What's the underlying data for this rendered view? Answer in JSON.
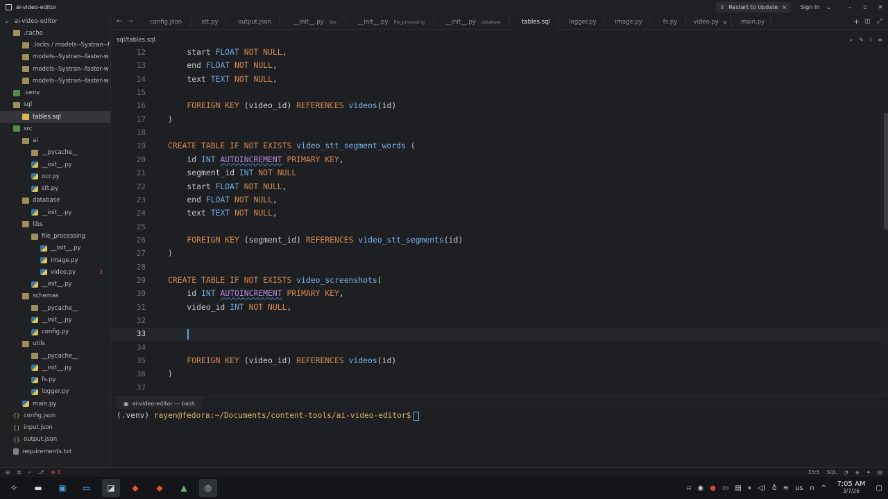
{
  "window": {
    "title": "ai-video-editor",
    "update_label": "Restart to Update",
    "sign_in_label": "Sign In"
  },
  "sidebar": {
    "items": [
      {
        "label": "ai-video-editor",
        "icon": "chevron-down-icon",
        "depth": 0
      },
      {
        "label": ".cache",
        "icon": "folder-icon",
        "depth": 1
      },
      {
        "label": ".locks / models--Systran--f",
        "icon": "folder-icon",
        "depth": 2
      },
      {
        "label": "models--Systran--faster-w",
        "icon": "folder-icon",
        "depth": 2
      },
      {
        "label": "models--Systran--faster-w",
        "icon": "folder-icon",
        "depth": 2
      },
      {
        "label": "models--Systran--faster-w",
        "icon": "folder-icon",
        "depth": 2
      },
      {
        "label": ".venv",
        "icon": "folder-src-icon",
        "depth": 1
      },
      {
        "label": "sql",
        "icon": "folder-icon",
        "depth": 1
      },
      {
        "label": "tables.sql",
        "icon": "sql-file-icon",
        "depth": 2,
        "selected": true
      },
      {
        "label": "src",
        "icon": "folder-src-icon",
        "depth": 1
      },
      {
        "label": "ai",
        "icon": "folder-icon",
        "depth": 2
      },
      {
        "label": "__pycache__",
        "icon": "folder-icon",
        "depth": 3
      },
      {
        "label": "__init__.py",
        "icon": "python-file-icon",
        "depth": 3
      },
      {
        "label": "ocr.py",
        "icon": "python-file-icon",
        "depth": 3
      },
      {
        "label": "stt.py",
        "icon": "python-file-icon",
        "depth": 3
      },
      {
        "label": "database",
        "icon": "folder-icon",
        "depth": 2
      },
      {
        "label": "__init__.py",
        "icon": "python-file-icon",
        "depth": 3
      },
      {
        "label": "libs",
        "icon": "folder-icon",
        "depth": 2
      },
      {
        "label": "file_processing",
        "icon": "folder-icon",
        "depth": 3
      },
      {
        "label": "__init__.py",
        "icon": "python-file-icon",
        "depth": 4
      },
      {
        "label": "image.py",
        "icon": "python-file-icon",
        "depth": 4
      },
      {
        "label": "video.py",
        "icon": "python-file-icon",
        "depth": 4,
        "badge": "3"
      },
      {
        "label": "__init__.py",
        "icon": "python-file-icon",
        "depth": 3
      },
      {
        "label": "schemas",
        "icon": "folder-icon",
        "depth": 2
      },
      {
        "label": "__pycache__",
        "icon": "folder-icon",
        "depth": 3
      },
      {
        "label": "__init__.py",
        "icon": "python-file-icon",
        "depth": 3
      },
      {
        "label": "config.py",
        "icon": "python-file-icon",
        "depth": 3
      },
      {
        "label": "utils",
        "icon": "folder-icon",
        "depth": 2
      },
      {
        "label": "__pycache__",
        "icon": "folder-icon",
        "depth": 3
      },
      {
        "label": "__init__.py",
        "icon": "python-file-icon",
        "depth": 3
      },
      {
        "label": "fs.py",
        "icon": "python-file-icon",
        "depth": 3
      },
      {
        "label": "logger.py",
        "icon": "python-file-icon",
        "depth": 3
      },
      {
        "label": "main.py",
        "icon": "python-file-icon",
        "depth": 2
      },
      {
        "label": "config.json",
        "icon": "json-file-icon",
        "depth": 1
      },
      {
        "label": "input.json",
        "icon": "json-file-icon",
        "depth": 1
      },
      {
        "label": "output.json",
        "icon": "json-file-icon",
        "depth": 1
      },
      {
        "label": "requirements.txt",
        "icon": "text-file-icon",
        "depth": 1
      }
    ]
  },
  "tabs": [
    {
      "label": "config.json",
      "hint": ""
    },
    {
      "label": "stt.py",
      "hint": ""
    },
    {
      "label": "output.json",
      "hint": ""
    },
    {
      "label": "__init__.py",
      "hint": "libs"
    },
    {
      "label": "__init__.py",
      "hint": "file_processing"
    },
    {
      "label": "__init__.py",
      "hint": "database"
    },
    {
      "label": "tables.sql",
      "hint": "",
      "active": true
    },
    {
      "label": "logger.py",
      "hint": ""
    },
    {
      "label": "image.py",
      "hint": ""
    },
    {
      "label": "fs.py",
      "hint": ""
    },
    {
      "label": "video.py",
      "hint": "",
      "hovered": true
    },
    {
      "label": "main.py",
      "hint": ""
    }
  ],
  "breadcrumb": "sql/tables.sql",
  "editor": {
    "current_line": "33",
    "lines": [
      {
        "n": "12",
        "tokens": [
          [
            "",
            "    start "
          ],
          [
            "ty",
            "FLOAT"
          ],
          [
            "kw",
            " NOT NULL"
          ],
          [
            "",
            ","
          ]
        ]
      },
      {
        "n": "13",
        "tokens": [
          [
            "",
            "    end "
          ],
          [
            "ty",
            "FLOAT"
          ],
          [
            "kw",
            " NOT NULL"
          ],
          [
            "",
            ","
          ]
        ]
      },
      {
        "n": "14",
        "tokens": [
          [
            "",
            "    text "
          ],
          [
            "ty",
            "TEXT"
          ],
          [
            "kw",
            " NOT NULL"
          ],
          [
            "",
            ","
          ]
        ]
      },
      {
        "n": "15",
        "tokens": []
      },
      {
        "n": "16",
        "tokens": [
          [
            "kw",
            "    FOREIGN KEY"
          ],
          [
            "",
            " (video_id) "
          ],
          [
            "kw",
            "REFERENCES"
          ],
          [
            "",
            " "
          ],
          [
            "tb",
            "videos"
          ],
          [
            "",
            "(id)"
          ]
        ]
      },
      {
        "n": "17",
        "tokens": [
          [
            "",
            ")"
          ]
        ]
      },
      {
        "n": "18",
        "tokens": []
      },
      {
        "n": "19",
        "tokens": [
          [
            "kw",
            "CREATE TABLE IF NOT EXISTS"
          ],
          [
            "",
            " "
          ],
          [
            "tb",
            "video_stt_segment_words"
          ],
          [
            "",
            " ("
          ]
        ]
      },
      {
        "n": "20",
        "tokens": [
          [
            "",
            "    id "
          ],
          [
            "ty",
            "INT"
          ],
          [
            "",
            " "
          ],
          [
            "sq",
            "AUTOINCREMENT"
          ],
          [
            "kw",
            " PRIMARY KEY"
          ],
          [
            "",
            ","
          ]
        ]
      },
      {
        "n": "21",
        "tokens": [
          [
            "",
            "    segment_id "
          ],
          [
            "ty",
            "INT"
          ],
          [
            "kw",
            " NOT NULL"
          ]
        ]
      },
      {
        "n": "22",
        "tokens": [
          [
            "",
            "    start "
          ],
          [
            "ty",
            "FLOAT"
          ],
          [
            "kw",
            " NOT NULL"
          ],
          [
            "",
            ","
          ]
        ]
      },
      {
        "n": "23",
        "tokens": [
          [
            "",
            "    end "
          ],
          [
            "ty",
            "FLOAT"
          ],
          [
            "kw",
            " NOT NULL"
          ],
          [
            "",
            ","
          ]
        ]
      },
      {
        "n": "24",
        "tokens": [
          [
            "",
            "    text "
          ],
          [
            "ty",
            "TEXT"
          ],
          [
            "kw",
            " NOT NULL"
          ],
          [
            "",
            ","
          ]
        ]
      },
      {
        "n": "25",
        "tokens": []
      },
      {
        "n": "26",
        "tokens": [
          [
            "kw",
            "    FOREIGN KEY"
          ],
          [
            "",
            " (segment_id) "
          ],
          [
            "kw",
            "REFERENCES"
          ],
          [
            "",
            " "
          ],
          [
            "tb",
            "video_stt_segments"
          ],
          [
            "",
            "(id)"
          ]
        ]
      },
      {
        "n": "27",
        "tokens": [
          [
            "",
            ")"
          ]
        ]
      },
      {
        "n": "28",
        "tokens": []
      },
      {
        "n": "29",
        "tokens": [
          [
            "kw",
            "CREATE TABLE IF NOT EXISTS"
          ],
          [
            "",
            " "
          ],
          [
            "tb",
            "video_screenshots"
          ],
          [
            "",
            "("
          ]
        ]
      },
      {
        "n": "30",
        "tokens": [
          [
            "",
            "    id "
          ],
          [
            "ty",
            "INT"
          ],
          [
            "",
            " "
          ],
          [
            "sq",
            "AUTOINCREMENT"
          ],
          [
            "kw",
            " PRIMARY KEY"
          ],
          [
            "",
            ","
          ]
        ]
      },
      {
        "n": "31",
        "tokens": [
          [
            "",
            "    video_id "
          ],
          [
            "ty",
            "INT"
          ],
          [
            "kw",
            " NOT NULL"
          ],
          [
            "",
            ","
          ]
        ]
      },
      {
        "n": "32",
        "tokens": []
      },
      {
        "n": "33",
        "tokens": []
      },
      {
        "n": "34",
        "tokens": []
      },
      {
        "n": "35",
        "tokens": [
          [
            "kw",
            "    FOREIGN KEY"
          ],
          [
            "",
            " (video_id) "
          ],
          [
            "kw",
            "REFERENCES"
          ],
          [
            "",
            " "
          ],
          [
            "tb",
            "videos"
          ],
          [
            "",
            "(id)"
          ]
        ]
      },
      {
        "n": "36",
        "tokens": [
          [
            "",
            ")"
          ]
        ]
      },
      {
        "n": "37",
        "tokens": []
      }
    ]
  },
  "terminal": {
    "tab_label": "ai-video-editor — bash",
    "env": "(.venv)",
    "user_path": "rayen@fedora:~/Documents/content-tools/ai-video-editor$"
  },
  "statusbar": {
    "errors": "3",
    "cursor_pos": "33:5",
    "language": "SQL"
  },
  "taskbar": {
    "time": "7:05 AM",
    "date": "3/7/26",
    "keyboard": "us"
  },
  "colors": {
    "keyword": "#d68a4f",
    "type": "#6fa9e3",
    "table_name": "#7cb4ef",
    "accent": "#5fa8e6",
    "error": "#e0575d"
  }
}
